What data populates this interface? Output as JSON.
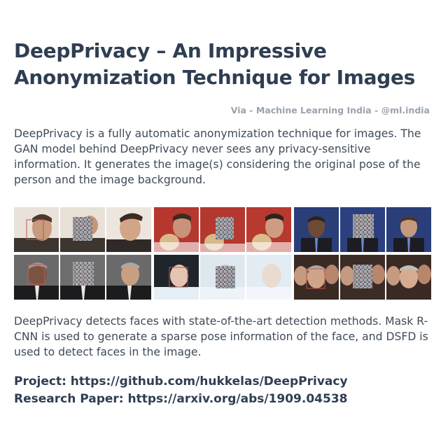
{
  "title_line1": "DeepPrivacy – An Impressive",
  "title_line2": "Anonymization Technique for Images",
  "via": "Via - Machine Learning India - @ml.india",
  "paragraph1": "DeepPrivacy is a fully automatic anonymization technique for images. The GAN model behind DeepPrivacy never sees any privacy-sensitive information. It generates the image(s) considering the original pose of the person and the image background.",
  "paragraph2": "DeepPrivacy detects faces with state-of-the-art detection methods. Mask R-CNN is used to generate a sparse pose information of the face, and DSFD is used to detect faces in the image.",
  "project_line": "Project: https://github.com/hukkelas/DeepPrivacy",
  "paper_line": "Research Paper: https://arxiv.org/abs/1909.04538",
  "colors": {
    "title": "#2f3e52",
    "body": "#3e4b5a",
    "via": "#9aa3ad",
    "box": "#c0584b"
  }
}
